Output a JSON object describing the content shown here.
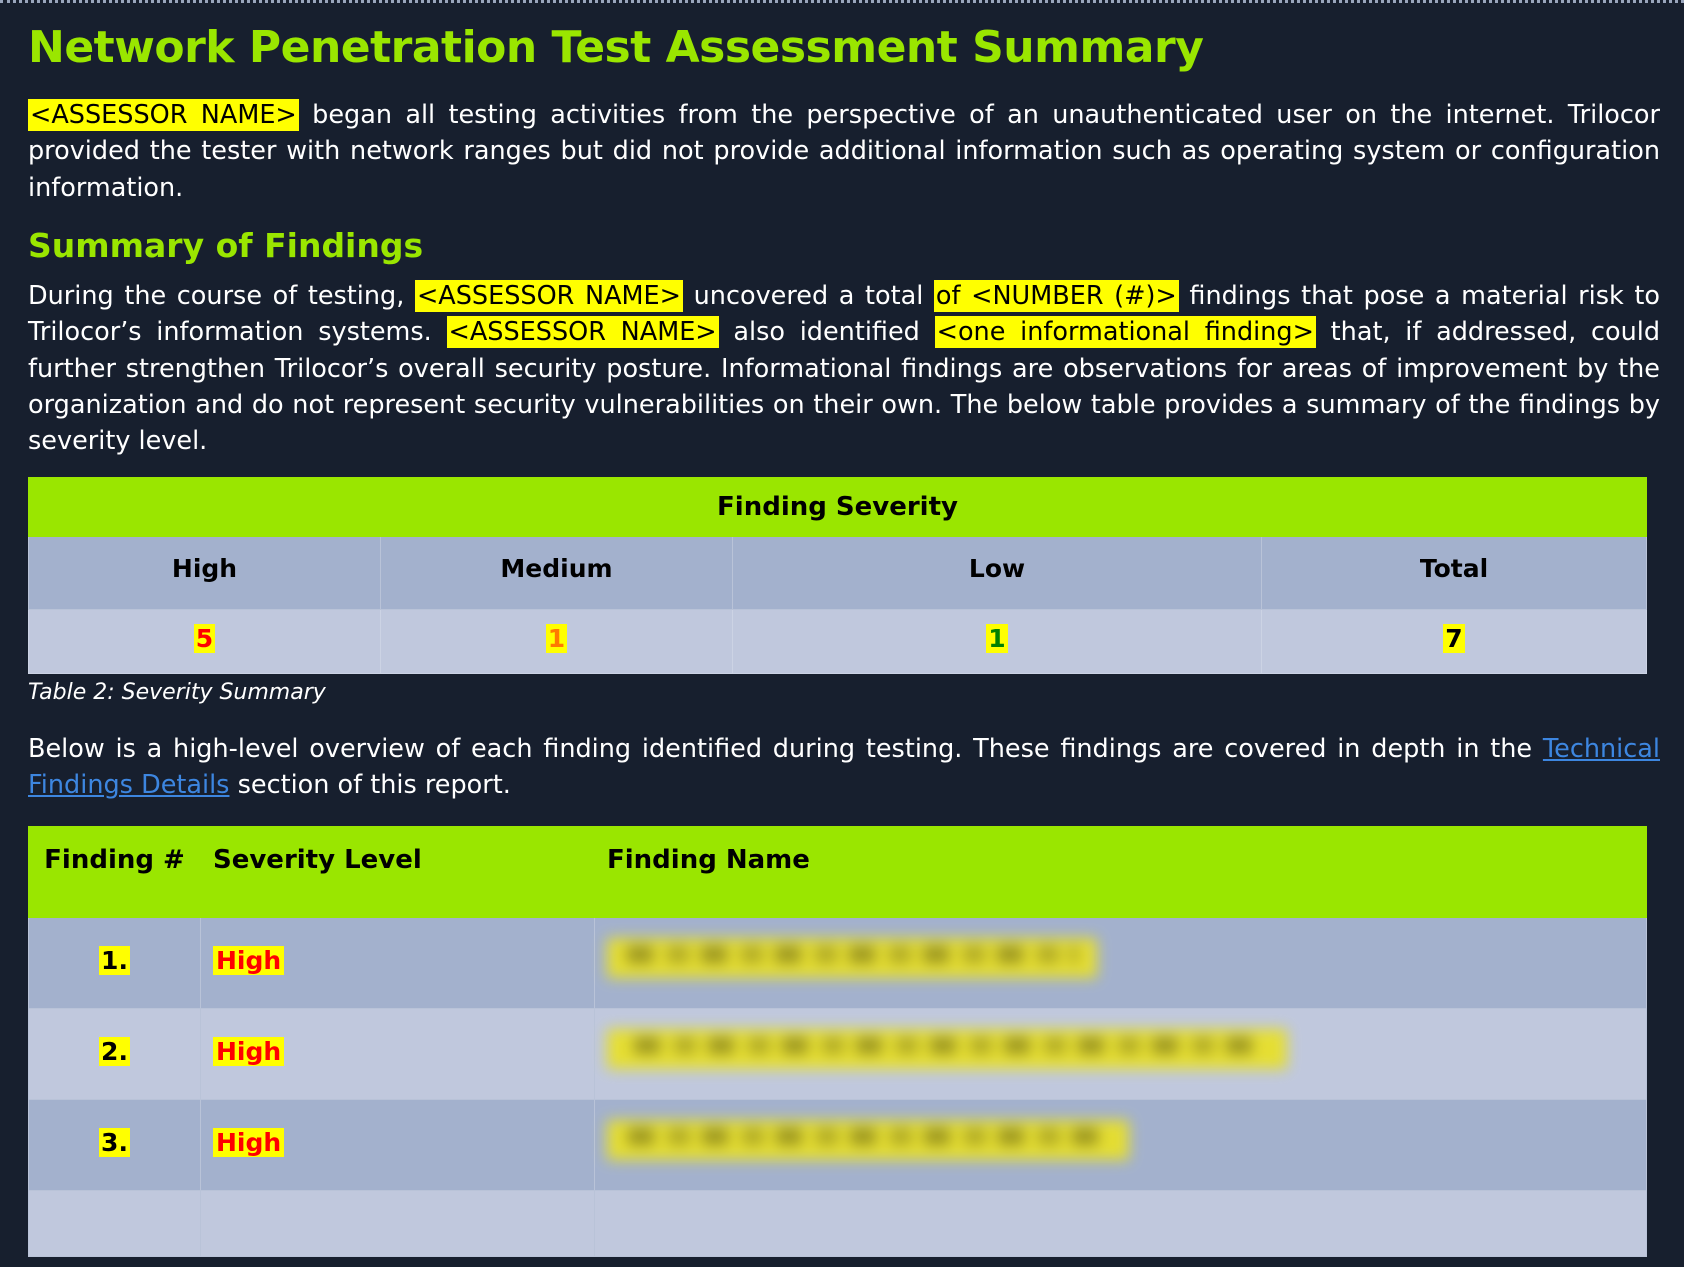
{
  "document": {
    "title": "Network Penetration Test Assessment Summary",
    "intro": {
      "assessor_placeholder": "<ASSESSOR NAME>",
      "rest": " began all testing activities from the perspective of an unauthenticated user on the internet.  Trilocor provided the tester with network ranges but did not provide additional information such as operating system or configuration information."
    },
    "section_heading": "Summary of Findings",
    "findings_para": {
      "p1": "During the course of testing, ",
      "hl1": "<ASSESSOR NAME>",
      "p2": " uncovered a total ",
      "hl2": "of <NUMBER (#)>",
      "p3": " findings that pose a material risk to Trilocor’s information systems. ",
      "hl3": "<ASSESSOR NAME>",
      "p4": " also identified ",
      "hl4": "<one informational finding>",
      "p5": " that, if addressed, could further strengthen Trilocor’s overall security posture. Informational findings are observations for areas of improvement by the organization and do not represent security vulnerabilities on their own. The below table provides a summary of the findings by severity level."
    },
    "overview_para": {
      "p1": "Below is a high-level overview of each finding identified during testing. These findings are covered in depth in the ",
      "link": "Technical Findings Details",
      "p2": " section of this report."
    }
  },
  "severity_table": {
    "caption": "Table 2: Severity Summary",
    "group_header": "Finding Severity",
    "columns": [
      "High",
      "Medium",
      "Low",
      "Total"
    ],
    "values": [
      "5",
      "1",
      "1",
      "7"
    ],
    "value_colors": [
      "#ff0000",
      "#ff7a00",
      "#008000",
      "#000000"
    ],
    "highlight_color": "#ffff00",
    "header_color": "#9ae600"
  },
  "findings_table": {
    "columns": [
      "Finding\n#",
      "Severity Level",
      "Finding Name"
    ],
    "col_finding_num": "Finding #",
    "col_severity": "Severity Level",
    "col_name": "Finding Name",
    "rows": [
      {
        "num": "1.",
        "severity": "High",
        "name": ""
      },
      {
        "num": "2.",
        "severity": "High",
        "name": ""
      },
      {
        "num": "3.",
        "severity": "High",
        "name": ""
      }
    ]
  },
  "theme": {
    "background": "#171f2e",
    "accent_green": "#9ae600",
    "link_blue": "#3d86e0",
    "table_row_dark": "#a3b1cd",
    "table_row_light": "#c0c8dd"
  }
}
